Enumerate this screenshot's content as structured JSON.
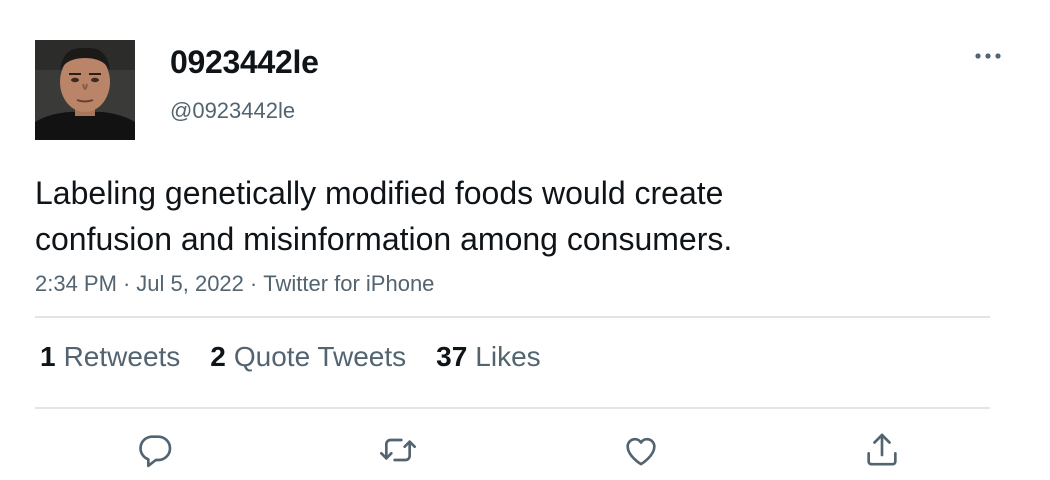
{
  "user": {
    "display_name": "0923442le",
    "handle": "@0923442le"
  },
  "tweet": {
    "text_lines": [
      "Labeling genetically modified foods would create",
      "confusion and misinformation among consumers."
    ],
    "time": "2:34 PM",
    "date": "Jul 5, 2022",
    "source": "Twitter for iPhone",
    "separator": "·"
  },
  "stats": [
    {
      "count": "1",
      "label": "Retweets"
    },
    {
      "count": "2",
      "label": "Quote Tweets"
    },
    {
      "count": "37",
      "label": "Likes"
    }
  ],
  "icons": {
    "more": "more-horizontal-icon",
    "reply": "reply-icon",
    "retweet": "retweet-icon",
    "like": "heart-icon",
    "share": "share-icon"
  },
  "colors": {
    "text": "#0f1419",
    "secondary": "#536471",
    "divider": "#e1e5e8"
  }
}
